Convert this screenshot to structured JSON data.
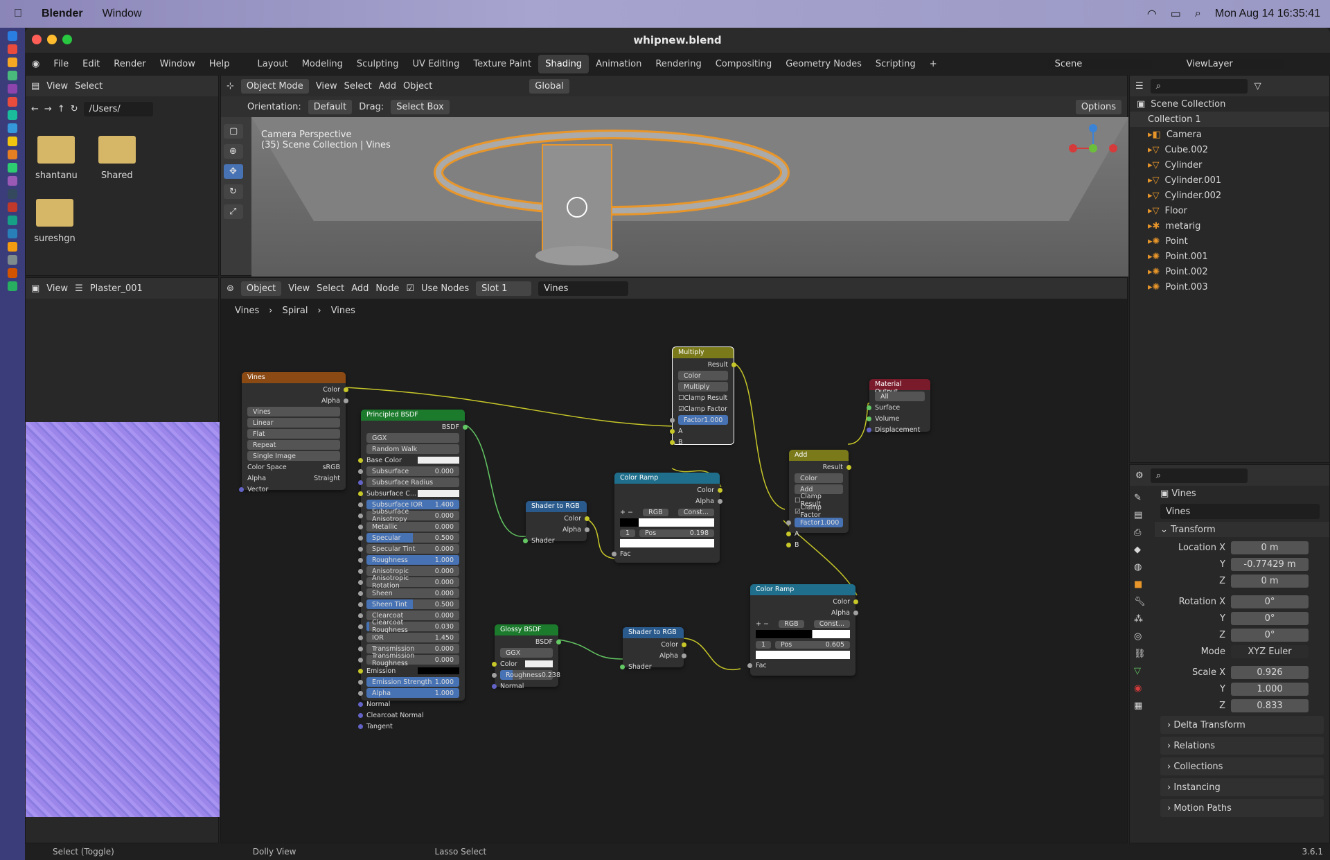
{
  "mac": {
    "app": "Blender",
    "window": "Window",
    "datetime": "Mon Aug 14  16:35:41"
  },
  "title": "whipnew.blend",
  "menu": [
    "File",
    "Edit",
    "Render",
    "Window",
    "Help"
  ],
  "workspaces": [
    "Layout",
    "Modeling",
    "Sculpting",
    "UV Editing",
    "Texture Paint",
    "Shading",
    "Animation",
    "Rendering",
    "Compositing",
    "Geometry Nodes",
    "Scripting"
  ],
  "active_workspace": "Shading",
  "scene": "Scene",
  "viewlayer": "ViewLayer",
  "filebrowser": {
    "view": "View",
    "select": "Select",
    "path": "/Users/",
    "folders": [
      "shantanu",
      "Shared",
      "sureshgn"
    ]
  },
  "viewport": {
    "mode": "Object Mode",
    "menus": [
      "View",
      "Select",
      "Add",
      "Object"
    ],
    "transform": "Global",
    "orientation_label": "Orientation:",
    "orientation": "Default",
    "drag_label": "Drag:",
    "drag": "Select Box",
    "options": "Options",
    "info1": "Camera Perspective",
    "info2": "(35) Scene Collection | Vines"
  },
  "image_editor": {
    "view": "View",
    "image": "Plaster_001"
  },
  "node_editor": {
    "mode": "Object",
    "menus": [
      "View",
      "Select",
      "Add",
      "Node"
    ],
    "use_nodes": "Use Nodes",
    "slot": "Slot 1",
    "material": "Vines",
    "breadcrumb": [
      "Vines",
      "Spiral",
      "Vines"
    ]
  },
  "nodes": {
    "vines": {
      "title": "Vines",
      "outputs": [
        "Color",
        "Alpha"
      ],
      "image": "Vines",
      "opts": [
        "Linear",
        "Flat",
        "Repeat",
        "Single Image"
      ],
      "colorspace_label": "Color Space",
      "colorspace": "sRGB",
      "alpha_label": "Alpha",
      "alpha": "Straight",
      "vector": "Vector"
    },
    "bsdf": {
      "title": "Principled BSDF",
      "out": "BSDF",
      "dist": "GGX",
      "sss": "Random Walk",
      "rows": [
        [
          "Subsurface",
          "0.000"
        ],
        [
          "Subsurface IOR",
          "1.400"
        ],
        [
          "Subsurface Anisotropy",
          "0.000"
        ],
        [
          "Metallic",
          "0.000"
        ],
        [
          "Specular",
          "0.500"
        ],
        [
          "Specular Tint",
          "0.000"
        ],
        [
          "Roughness",
          "1.000"
        ],
        [
          "Anisotropic",
          "0.000"
        ],
        [
          "Anisotropic Rotation",
          "0.000"
        ],
        [
          "Sheen",
          "0.000"
        ],
        [
          "Sheen Tint",
          "0.500"
        ],
        [
          "Clearcoat",
          "0.000"
        ],
        [
          "Clearcoat Roughness",
          "0.030"
        ],
        [
          "IOR",
          "1.450"
        ],
        [
          "Transmission",
          "0.000"
        ],
        [
          "Transmission Roughness",
          "0.000"
        ]
      ],
      "emstr": [
        "Emission Strength",
        "1.000"
      ],
      "alpha": [
        "Alpha",
        "1.000"
      ],
      "base": "Base Color",
      "ssr": "Subsurface Radius",
      "ssc": "Subsurface C...",
      "emission": "Emission",
      "inputs": [
        "Normal",
        "Clearcoat Normal",
        "Tangent"
      ]
    },
    "multiply": {
      "title": "Multiply",
      "result": "Result",
      "type": "Color",
      "op": "Multiply",
      "clamp1": "Clamp Result",
      "clamp2": "Clamp Factor",
      "factor": "Factor",
      "factor_val": "1.000",
      "a": "A",
      "b": "B"
    },
    "add": {
      "title": "Add",
      "result": "Result",
      "type": "Color",
      "op": "Add",
      "clamp1": "Clamp Result",
      "clamp2": "Clamp Factor",
      "factor": "Factor",
      "factor_val": "1.000",
      "a": "A",
      "b": "B"
    },
    "out": {
      "title": "Material Output",
      "target": "All",
      "inputs": [
        "Surface",
        "Volume",
        "Displacement"
      ]
    },
    "s2r1": {
      "title": "Shader to RGB",
      "outputs": [
        "Color",
        "Alpha"
      ],
      "input": "Shader"
    },
    "s2r2": {
      "title": "Shader to RGB",
      "outputs": [
        "Color",
        "Alpha"
      ],
      "input": "Shader"
    },
    "ramp1": {
      "title": "Color Ramp",
      "outputs": [
        "Color",
        "Alpha"
      ],
      "mode": "RGB",
      "interp": "Const...",
      "idx": "1",
      "pos": "Pos",
      "pos_val": "0.198",
      "fac": "Fac"
    },
    "ramp2": {
      "title": "Color Ramp",
      "outputs": [
        "Color",
        "Alpha"
      ],
      "mode": "RGB",
      "interp": "Const...",
      "idx": "1",
      "pos": "Pos",
      "pos_val": "0.605",
      "fac": "Fac"
    },
    "glossy": {
      "title": "Glossy BSDF",
      "out": "BSDF",
      "dist": "GGX",
      "color": "Color",
      "rough": "Roughness",
      "rough_val": "0.238",
      "normal": "Normal"
    }
  },
  "outliner": {
    "root": "Scene Collection",
    "items": [
      "Collection 1",
      "Camera",
      "Cube.002",
      "Cylinder",
      "Cylinder.001",
      "Cylinder.002",
      "Floor",
      "metarig",
      "Point",
      "Point.001",
      "Point.002",
      "Point.003"
    ]
  },
  "properties": {
    "object": "Vines",
    "name": "Vines",
    "transform": "Transform",
    "rows": [
      [
        "Location X",
        "0 m"
      ],
      [
        "Y",
        "-0.77429 m"
      ],
      [
        "Z",
        "0 m"
      ],
      [
        "Rotation X",
        "0°"
      ],
      [
        "Y",
        "0°"
      ],
      [
        "Z",
        "0°"
      ],
      [
        "Mode",
        "XYZ Euler"
      ],
      [
        "Scale X",
        "0.926"
      ],
      [
        "Y",
        "1.000"
      ],
      [
        "Z",
        "0.833"
      ]
    ],
    "sections": [
      "Delta Transform",
      "Relations",
      "Collections",
      "Instancing",
      "Motion Paths"
    ]
  },
  "status": {
    "s1": "Select (Toggle)",
    "s2": "Dolly View",
    "s3": "Lasso Select",
    "version": "3.6.1"
  }
}
